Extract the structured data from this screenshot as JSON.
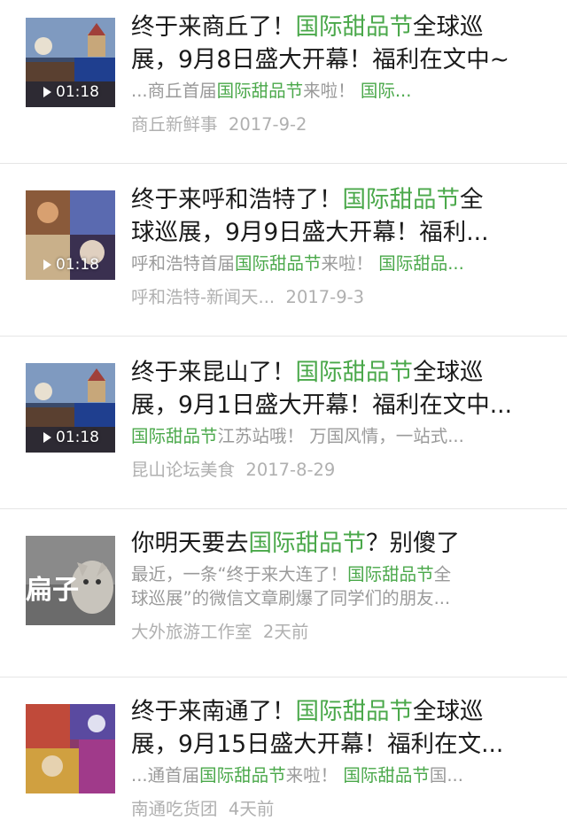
{
  "articles": [
    {
      "title_pre": "终于来商丘了！",
      "title_hl": "国际甜品节",
      "title_post": "全球巡",
      "title2_pre": "",
      "title2_hl": "",
      "title2_post": "展，9月8日盛大开幕！福利在文中~",
      "digest_pre": "...商丘首届",
      "digest_hl": "国际甜品节",
      "digest_mid": "来啦！ ",
      "digest_hl2": "国际...",
      "digest_post": "",
      "source": "商丘新鲜事",
      "date": "2017-9-2",
      "duration": "01:18"
    },
    {
      "title_pre": "终于来呼和浩特了！",
      "title_hl": "国际甜品节",
      "title_post": "全",
      "title2_pre": "",
      "title2_hl": "",
      "title2_post": "球巡展，9月9日盛大开幕！福利...",
      "digest_pre": "呼和浩特首届",
      "digest_hl": "国际甜品节",
      "digest_mid": "来啦！ ",
      "digest_hl2": "国际甜品...",
      "digest_post": "",
      "source": "呼和浩特-新闻天...",
      "date": "2017-9-3",
      "duration": "01:18"
    },
    {
      "title_pre": "终于来昆山了！",
      "title_hl": "国际甜品节",
      "title_post": "全球巡",
      "title2_pre": "",
      "title2_hl": "",
      "title2_post": "展，9月1日盛大开幕！福利在文中...",
      "digest_pre": "",
      "digest_hl": "国际甜品节",
      "digest_mid": "江苏站哦！ 万国风情，一站式...",
      "digest_hl2": "",
      "digest_post": "",
      "source": "昆山论坛美食",
      "date": "2017-8-29",
      "duration": "01:18"
    },
    {
      "title_pre": "你明天要去",
      "title_hl": "国际甜品节",
      "title_post": "？别傻了",
      "digest_pre": "最近，一条“终于来大连了！",
      "digest_hl": "国际甜品节",
      "digest_mid": "全",
      "digest2": "球巡展”的微信文章刷爆了同学们的朋友...",
      "source": "大外旅游工作室",
      "date": "2天前",
      "stamp": "扁子"
    },
    {
      "title_pre": "终于来南通了！",
      "title_hl": "国际甜品节",
      "title_post": "全球巡",
      "title2_pre": "",
      "title2_hl": "",
      "title2_post": "展，9月15日盛大开幕！福利在文...",
      "digest_pre": "...通首届",
      "digest_hl": "国际甜品节",
      "digest_mid": "来啦！ ",
      "digest_hl2": "国际甜品节",
      "digest_post": "国...",
      "source": "南通吃货团",
      "date": "4天前"
    }
  ]
}
